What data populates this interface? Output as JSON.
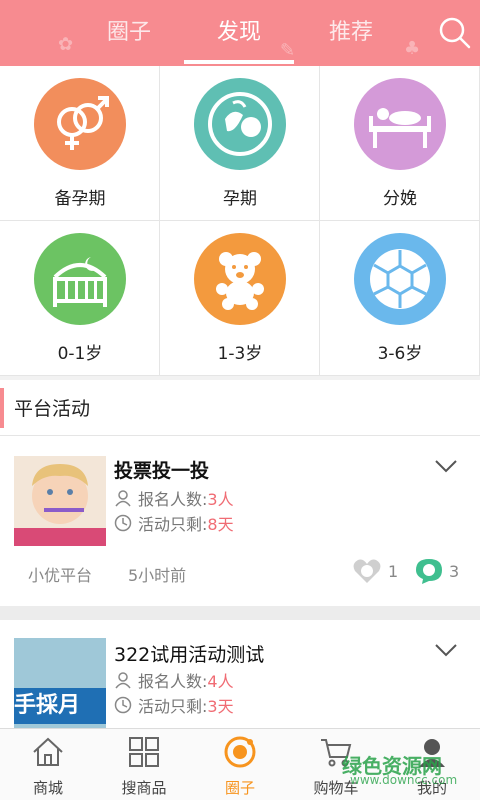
{
  "header": {
    "tabs": [
      {
        "label": "圈子",
        "active": false
      },
      {
        "label": "发现",
        "active": true
      },
      {
        "label": "推荐",
        "active": false
      }
    ],
    "search_icon": "search-icon",
    "background": "#f78b90"
  },
  "categories": [
    {
      "label": "备孕期",
      "icon": "gender-icon",
      "color": "#f28e5c"
    },
    {
      "label": "孕期",
      "icon": "fetus-icon",
      "color": "#5fbfb3"
    },
    {
      "label": "分娩",
      "icon": "delivery-bed-icon",
      "color": "#d49ad8"
    },
    {
      "label": "0-1岁",
      "icon": "crib-icon",
      "color": "#6cc363"
    },
    {
      "label": "1-3岁",
      "icon": "teddy-bear-icon",
      "color": "#f39a3e"
    },
    {
      "label": "3-6岁",
      "icon": "ball-icon",
      "color": "#6ab8ec"
    }
  ],
  "section": {
    "title": "平台活动"
  },
  "activities": [
    {
      "title": "投票投一投",
      "signup_label": "报名人数:",
      "signup_value": "3人",
      "remain_label": "活动只剩:",
      "remain_value": "8天",
      "source": "小优平台",
      "time": "5小时前",
      "likes": "1",
      "comments": "3"
    },
    {
      "title": "322试用活动测试",
      "signup_label": "报名人数:",
      "signup_value": "4人",
      "remain_label": "活动只剩:",
      "remain_value": "3天",
      "thumb_text": "手採月"
    }
  ],
  "bottom_nav": [
    {
      "label": "商城",
      "icon": "home-icon",
      "active": false
    },
    {
      "label": "搜商品",
      "icon": "grid-icon",
      "active": false
    },
    {
      "label": "圈子",
      "icon": "circle-icon",
      "active": true
    },
    {
      "label": "购物车",
      "icon": "cart-icon",
      "active": false
    },
    {
      "label": "我的",
      "icon": "profile-icon",
      "active": false
    }
  ],
  "watermark": {
    "line1": "绿色资源网",
    "line2": "www.downcc.com"
  },
  "accent_color": "#f7941e",
  "highlight_color": "#f06c74"
}
